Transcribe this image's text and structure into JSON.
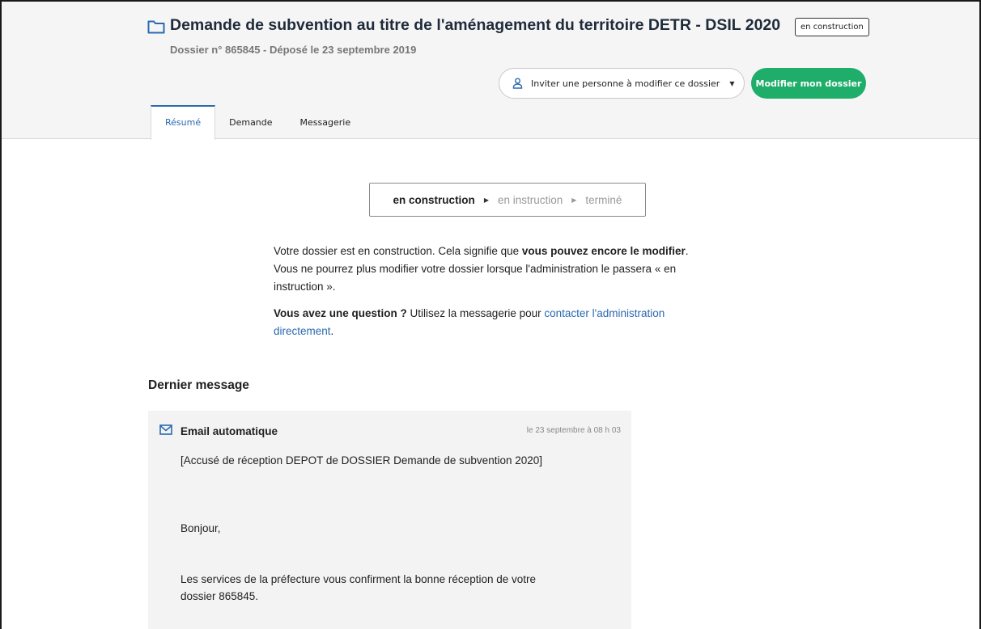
{
  "header": {
    "title": "Demande de subvention au titre de l'aménagement du territoire DETR - DSIL 2020",
    "status_tag": "en construction",
    "subtitle": "Dossier n° 865845 - Déposé le 23 septembre 2019",
    "invite_button": "Inviter une personne à modifier ce dossier",
    "edit_button": "Modifier mon dossier"
  },
  "tabs": [
    {
      "label": "Résumé",
      "active": true
    },
    {
      "label": "Demande",
      "active": false
    },
    {
      "label": "Messagerie",
      "active": false
    }
  ],
  "progress": {
    "current": "en construction",
    "step2": "en instruction",
    "step3": "terminé"
  },
  "info": {
    "p1_a": "Votre dossier est en construction. Cela signifie que ",
    "p1_bold": "vous pouvez encore le modifier",
    "p1_b": ". Vous ne pourrez plus modifier votre dossier lorsque l'administration le passera « en instruction ».",
    "p2_bold": "Vous avez une question ?",
    "p2_a": " Utilisez la messagerie pour ",
    "p2_link": "contacter l'administration directement",
    "p2_end": "."
  },
  "last_message": {
    "section_title": "Dernier message",
    "sender": "Email automatique",
    "date": "le 23 septembre à 08 h 03",
    "subject": "[Accusé de réception DEPOT de DOSSIER Demande de subvention 2020]",
    "greeting": "Bonjour,",
    "body_1": "Les services de la préfecture vous confirment la bonne réception de votre",
    "body_2": "dossier 865845."
  },
  "colors": {
    "accent": "#2b6ab0",
    "green": "#1fae6a"
  }
}
